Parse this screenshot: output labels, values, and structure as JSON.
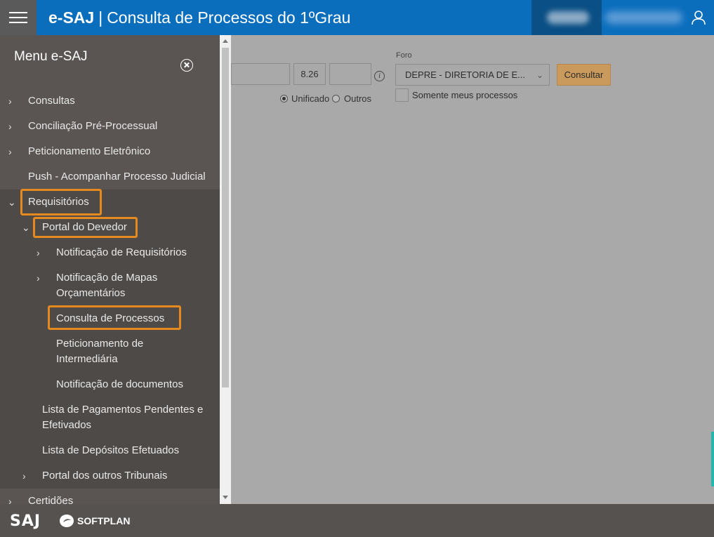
{
  "header": {
    "brand_bold": "e-SAJ",
    "separator": "|",
    "title": "Consulta de Processos do 1ºGrau",
    "colors": {
      "bar": "#0a6ebd",
      "hamburger_bg": "#5a5a5a"
    }
  },
  "sidebar": {
    "title": "Menu e-SAJ",
    "items": [
      {
        "label": "Consultas",
        "chevron": ">"
      },
      {
        "label": "Conciliação Pré-Processual",
        "chevron": ">"
      },
      {
        "label": "Peticionamento Eletrônico",
        "chevron": ">"
      },
      {
        "label": "Push - Acompanhar Processo Judicial",
        "chevron": ""
      },
      {
        "label": "Requisitórios",
        "chevron": "v",
        "highlighted": true
      },
      {
        "label": "Portal do Devedor",
        "chevron": "v",
        "highlighted": true
      },
      {
        "label": "Notificação de Requisitórios",
        "chevron": ">"
      },
      {
        "label": "Notificação de Mapas",
        "label2": "Orçamentários",
        "chevron": ">"
      },
      {
        "label": "Consulta de Processos",
        "highlighted": true
      },
      {
        "label": "Peticionamento de",
        "label2": "Intermediária"
      },
      {
        "label": "Notificação de documentos"
      },
      {
        "label": "Lista de Pagamentos Pendentes e",
        "label2": "Efetivados"
      },
      {
        "label": "Lista de Depósitos Efetuados"
      },
      {
        "label": "Portal dos outros Tribunais",
        "chevron": ">"
      },
      {
        "label": "Certidões",
        "chevron": ">"
      }
    ],
    "highlight_color": "#e58a1f"
  },
  "form": {
    "number_field_1": "",
    "number_field_2": "8.26",
    "number_field_3": "",
    "radio_unificado": "Unificado",
    "radio_outros": "Outros",
    "foro_label": "Foro",
    "foro_value": "DEPRE - DIRETORIA DE E...",
    "consultar_label": "Consultar",
    "somente_label": "Somente meus processos",
    "button_color": "#c99a5b"
  },
  "footer": {
    "saj_logo": "SAJ",
    "softplan_logo": "SOFTPLAN"
  }
}
